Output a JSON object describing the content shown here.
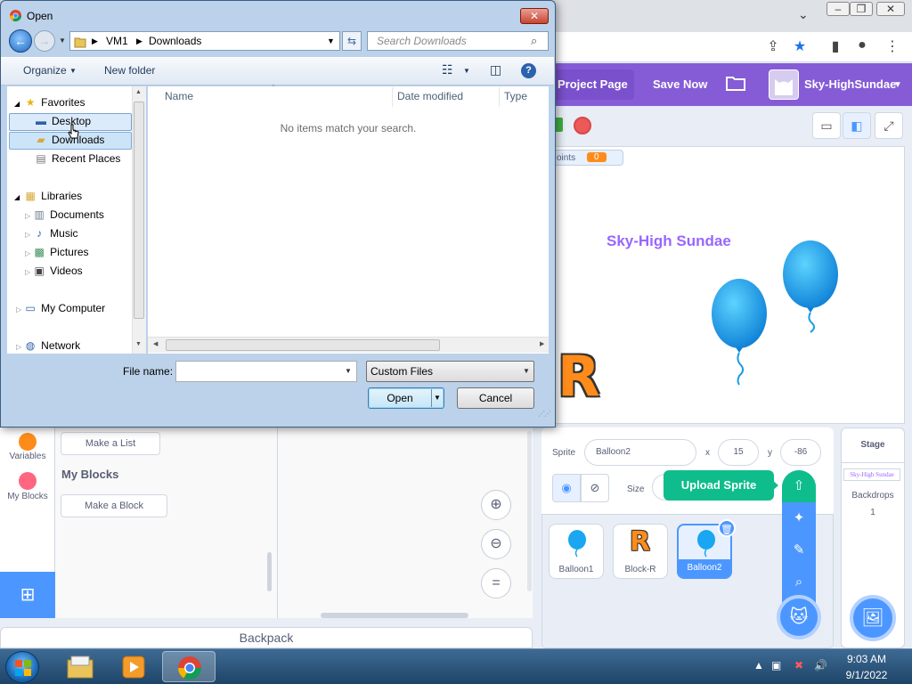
{
  "browser": {
    "window_controls": [
      "–",
      "❐",
      "✕"
    ]
  },
  "scratch": {
    "menu": {
      "project_page": "Project Page",
      "save_now": "Save Now",
      "username": "Sky-HighSundae"
    },
    "stage": {
      "variable_label": "oints",
      "variable_value": "0",
      "title_text": "Sky-High Sundae",
      "block_letter": "R"
    },
    "sprite_info": {
      "sprite_label": "Sprite",
      "sprite_name": "Balloon2",
      "x_label": "x",
      "x_value": "15",
      "y_label": "y",
      "y_value": "-86",
      "size_label": "Size"
    },
    "sprites": [
      {
        "name": "Balloon1"
      },
      {
        "name": "Block-R"
      },
      {
        "name": "Balloon2"
      }
    ],
    "tooltip": "Upload Sprite",
    "stage_selector": {
      "header": "Stage",
      "thumb_text": "Sky-High Sundae",
      "backdrops_label": "Backdrops",
      "backdrops_count": "1"
    },
    "categories": [
      {
        "label": "Variables",
        "color": "#ff8c1a"
      },
      {
        "label": "My Blocks",
        "color": "#ff6680"
      }
    ],
    "palette": {
      "make_list": "Make a List",
      "my_blocks_heading": "My Blocks",
      "make_block": "Make a Block"
    },
    "backpack": "Backpack"
  },
  "dialog": {
    "title": "Open",
    "breadcrumb": [
      "VM1",
      "Downloads"
    ],
    "search_placeholder": "Search Downloads",
    "organize": "Organize",
    "new_folder": "New folder",
    "nav": {
      "favorites": "Favorites",
      "desktop": "Desktop",
      "downloads": "Downloads",
      "recent_places": "Recent Places",
      "libraries": "Libraries",
      "documents": "Documents",
      "music": "Music",
      "pictures": "Pictures",
      "videos": "Videos",
      "my_computer": "My Computer",
      "network": "Network"
    },
    "columns": [
      "Name",
      "Date modified",
      "Type"
    ],
    "empty_message": "No items match your search.",
    "file_name_label": "File name:",
    "file_name_value": "",
    "file_type": "Custom Files",
    "open_button": "Open",
    "cancel_button": "Cancel"
  },
  "taskbar": {
    "time": "9:03 AM",
    "date": "9/1/2022"
  },
  "colors": {
    "scratch_purple": "#855cd6",
    "scratch_blue": "#4c97ff",
    "upload_green": "#0fbd8c"
  }
}
